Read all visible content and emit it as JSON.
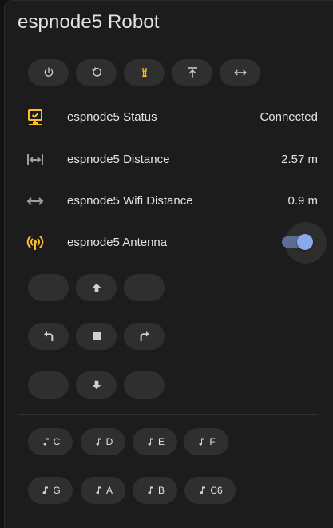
{
  "card": {
    "title": "espnode5 Robot"
  },
  "top_buttons": [
    {
      "icon": "power-icon"
    },
    {
      "icon": "restart-icon"
    },
    {
      "icon": "wrench-icon"
    },
    {
      "icon": "arrow-collapse-up-icon"
    },
    {
      "icon": "arrow-left-right-icon"
    }
  ],
  "entities": {
    "status": {
      "icon": "monitor-network-icon",
      "label": "espnode5 Status",
      "value": "Connected"
    },
    "distance": {
      "icon": "arrow-expand-horizontal-icon",
      "label": "espnode5 Distance",
      "value": "2.57 m"
    },
    "wifi_distance": {
      "icon": "arrow-left-right-icon",
      "label": "espnode5 Wifi Distance",
      "value": "0.9 m"
    },
    "antenna": {
      "icon": "access-point-icon",
      "label": "espnode5 Antenna",
      "state": "on"
    }
  },
  "dpad": {
    "up": {
      "icon": "arrow-up-bold-icon"
    },
    "left_turn": {
      "icon": "arrow-u-left-icon"
    },
    "stop": {
      "icon": "stop-icon"
    },
    "right_turn": {
      "icon": "arrow-u-right-icon"
    },
    "down": {
      "icon": "arrow-down-bold-icon"
    }
  },
  "notes": {
    "row1": [
      "C",
      "D",
      "E",
      "F"
    ],
    "row2": [
      "G",
      "A",
      "B",
      "C6"
    ]
  },
  "colors": {
    "accent_yellow": "#fbc02d",
    "icon_gray": "#9e9e9e",
    "toggle_on": "#8aa9ec",
    "text": "#e3e3e3"
  }
}
